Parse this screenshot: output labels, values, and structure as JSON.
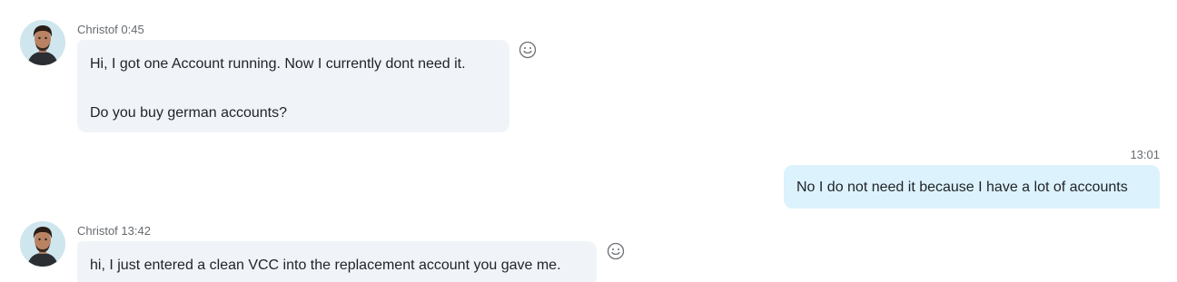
{
  "scroll_hint": "’",
  "messages": [
    {
      "sender": "Christof",
      "time": "0:45",
      "lines": [
        "Hi, I got one Account running. Now I currently dont need it.",
        "",
        "Do you buy german accounts?"
      ]
    },
    {
      "time": "13:01",
      "lines": [
        "No I do not need it because I have a lot of accounts"
      ]
    },
    {
      "sender": "Christof",
      "time": "13:42",
      "lines": [
        "hi, I just entered a clean VCC into the replacement account you gave me."
      ]
    }
  ],
  "icons": {
    "avatar": "person-avatar",
    "reaction": "smiley-icon"
  },
  "colors": {
    "incoming_bubble": "#f0f4f8",
    "outgoing_bubble": "#dcf2fc",
    "meta_text": "#666a70"
  }
}
